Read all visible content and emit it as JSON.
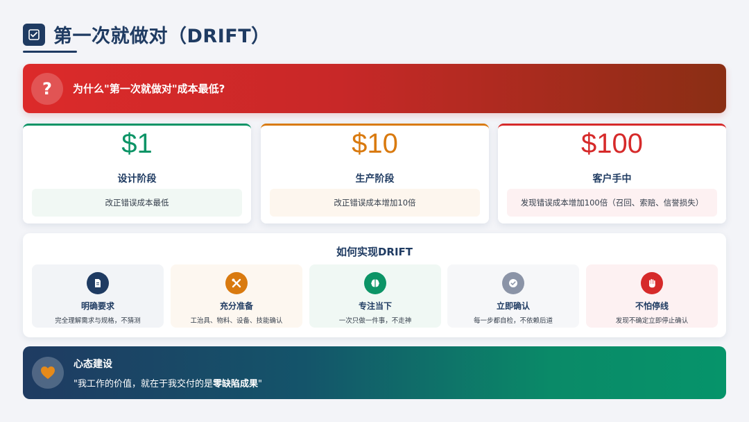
{
  "header": {
    "title": "第一次就做对（DRIFT）",
    "icon": "checklist-icon"
  },
  "question": {
    "text": "为什么\"第一次就做对\"成本最低?",
    "icon_glyph": "?"
  },
  "costs": [
    {
      "amount": "$1",
      "stage": "设计阶段",
      "desc": "改正错误成本最低",
      "color": "#0c9466"
    },
    {
      "amount": "$10",
      "stage": "生产阶段",
      "desc": "改正错误成本增加10倍",
      "color": "#d97a0f"
    },
    {
      "amount": "$100",
      "stage": "客户手中",
      "desc": "发现错误成本增加100倍（召回、索赔、信誉损失）",
      "color": "#d62a2a"
    }
  ],
  "drift": {
    "title": "如何实现DRIFT",
    "steps": [
      {
        "title": "明确要求",
        "desc": "完全理解需求与规格，不猜测",
        "icon": "document-icon",
        "color": "#1f3b62"
      },
      {
        "title": "充分准备",
        "desc": "工治具、物料、设备、技能确认",
        "icon": "tools-icon",
        "color": "#d97a0f"
      },
      {
        "title": "专注当下",
        "desc": "一次只做一件事，不走神",
        "icon": "brain-icon",
        "color": "#0c9466"
      },
      {
        "title": "立即确认",
        "desc": "每一步都自检，不依赖后道",
        "icon": "check-badge-icon",
        "color": "#8b94a7"
      },
      {
        "title": "不怕停线",
        "desc": "发现不确定立即停止确认",
        "icon": "stop-hand-icon",
        "color": "#d62a2a"
      }
    ]
  },
  "mindset": {
    "title": "心态建设",
    "quote_prefix": "\"我工作的价值，就在于我交付的是",
    "quote_bold": "零缺陷成果",
    "quote_suffix": "\"",
    "icon": "heart-icon",
    "heart_color": "#e58a1a"
  }
}
